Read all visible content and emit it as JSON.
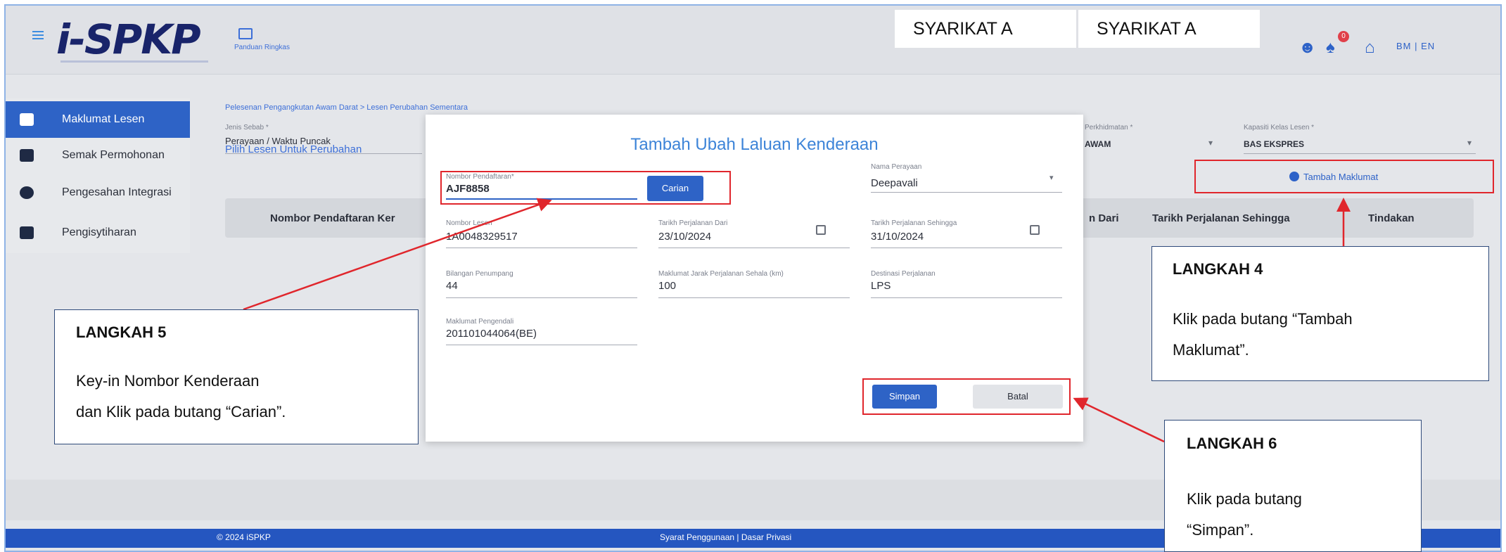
{
  "header": {
    "logo": "i-SPKP",
    "guide_label": "Panduan Ringkas",
    "company_1": "SYARIKAT A",
    "company_2": "SYARIKAT A",
    "notification_count": "0",
    "language": "BM | EN",
    "icons": [
      "menu-icon",
      "guide-icon",
      "user-icon",
      "bell-icon",
      "home-icon"
    ]
  },
  "sidebar": {
    "items": [
      {
        "label": "Maklumat Lesen",
        "icon": "folder-icon",
        "active": true
      },
      {
        "label": "Semak Permohonan",
        "icon": "message-icon",
        "active": false
      },
      {
        "label": "Pengesahan Integrasi",
        "icon": "check-circle-icon",
        "active": false
      },
      {
        "label": "Pengisytiharan",
        "icon": "clipboard-icon",
        "active": false
      }
    ]
  },
  "main": {
    "breadcrumb": "Pelesenan Pengangkutan Awam Darat > Lesen Perubahan Sementara",
    "jenis_sebab_label": "Jenis Sebab *",
    "jenis_sebab_value": "Perayaan / Waktu Puncak",
    "perkhidmatan_label": "Perkhidmatan *",
    "perkhidmatan_value": "AWAM",
    "kapasiti_label": "Kapasiti Kelas Lesen *",
    "kapasiti_value": "BAS EKSPRES",
    "pilih_lesen": "Pilih Lesen Untuk Perubahan",
    "tambah_button": "Tambah Maklumat",
    "table_headers": [
      "Nombor Pendaftaran Ker",
      "n Dari",
      "Tarikh Perjalanan Sehingga",
      "Tindakan"
    ]
  },
  "modal": {
    "title": "Tambah Ubah Laluan Kenderaan",
    "nombor_pendaftaran_label": "Nombor Pendaftaran*",
    "nombor_pendaftaran_value": "AJF8858",
    "carian_button": "Carian",
    "nama_perayaan_label": "Nama Perayaan",
    "nama_perayaan_value": "Deepavali",
    "nombor_lesen_label": "Nombor Lesen",
    "nombor_lesen_value": "1A0048329517",
    "tarikh_dari_label": "Tarikh Perjalanan Dari",
    "tarikh_dari_value": "23/10/2024",
    "tarikh_sehingga_label": "Tarikh Perjalanan Sehingga",
    "tarikh_sehingga_value": "31/10/2024",
    "bilangan_label": "Bilangan Penumpang",
    "bilangan_value": "44",
    "jarak_label": "Maklumat Jarak Perjalanan Sehala (km)",
    "jarak_value": "100",
    "destinasi_label": "Destinasi Perjalanan",
    "destinasi_value": "LPS",
    "pengendali_label": "Maklumat Pengendali",
    "pengendali_value": "201101044064(BE)",
    "simpan_button": "Simpan",
    "batal_button": "Batal"
  },
  "callouts": {
    "step4_title": "LANGKAH 4",
    "step4_line1": "Klik pada butang “Tambah",
    "step4_line2": "Maklumat”.",
    "step5_title": "LANGKAH 5",
    "step5_line1": "Key-in Nombor Kenderaan",
    "step5_line2": "dan Klik pada butang “Carian”.",
    "step6_title": "LANGKAH 6",
    "step6_line1": "Klik pada butang",
    "step6_line2": "“Simpan”."
  },
  "footer": {
    "copyright": "© 2024 iSPKP",
    "links": "Syarat Penggunaan | Dasar Privasi"
  },
  "colors": {
    "primary": "#2e63c6",
    "accent_blue": "#3d84d8",
    "annotation_red": "#e0262c",
    "footer_blue": "#2556c0"
  }
}
